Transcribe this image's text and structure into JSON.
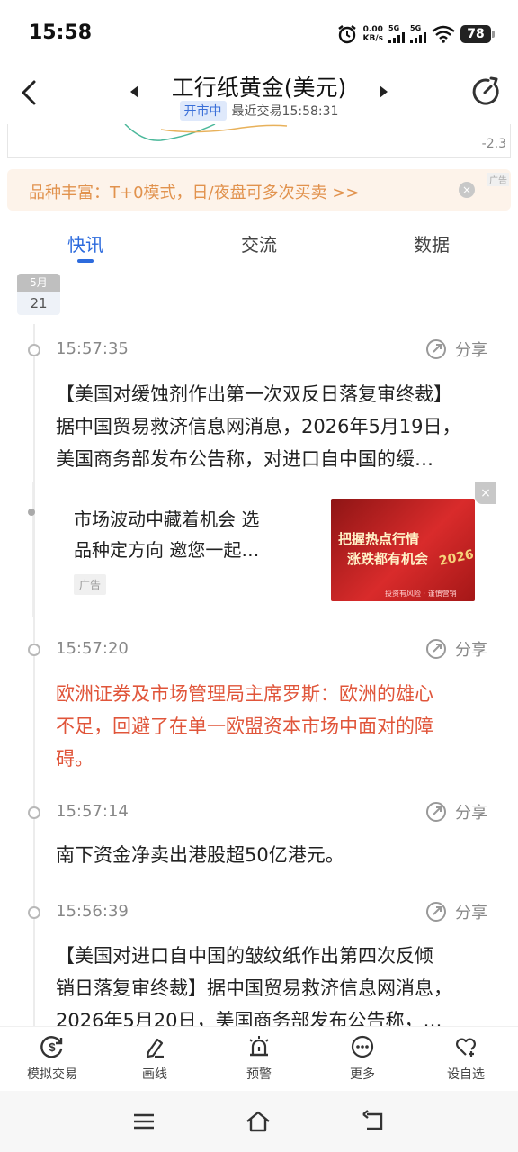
{
  "status_bar": {
    "time": "15:58",
    "net_speed_value": "0.00",
    "net_speed_unit": "KB/s",
    "signal1": "5G",
    "signal2": "5G",
    "battery": "78"
  },
  "header": {
    "title": "工行纸黄金(美元)",
    "market_status": "开市中",
    "last_trade": "最近交易15:58:31"
  },
  "chart_strip": {
    "value_label": "-2.3"
  },
  "ad_banner": {
    "text": "品种丰富：T+0模式，日/夜盘可多次买卖 >>",
    "tag": "广告",
    "close": "×"
  },
  "tabs": [
    {
      "label": "快讯",
      "active": true
    },
    {
      "label": "交流",
      "active": false
    },
    {
      "label": "数据",
      "active": false
    }
  ],
  "date": {
    "month": "5月",
    "day": "21"
  },
  "share_label": "分享",
  "news": [
    {
      "time": "15:57:35",
      "lines": [
        "【美国对缓蚀剂作出第一次双反日落复审终裁】",
        "据中国贸易救济信息网消息，2026年5月19日，",
        "美国商务部发布公告称，对进口自中国的缓…"
      ],
      "highlight": false
    },
    {
      "time": "15:57:20",
      "lines": [
        "欧洲证券及市场管理局主席罗斯：欧洲的雄心",
        "不足，回避了在单一欧盟资本市场中面对的障",
        "碍。"
      ],
      "highlight": true
    },
    {
      "time": "15:57:14",
      "lines": [
        "南下资金净卖出港股超50亿港元。"
      ],
      "highlight": false
    },
    {
      "time": "15:56:39",
      "lines": [
        "【美国对进口自中国的皱纹纸作出第四次反倾",
        "销日落复审终裁】据中国贸易救济信息网消息，",
        "2026年5月20日，美国商务部发布公告称，…"
      ],
      "highlight": false
    }
  ],
  "inline_ad": {
    "line1": "市场波动中藏着机会 选",
    "line2": "品种定方向 邀您一起…",
    "tag": "广告",
    "image_line1": "把握热点行情",
    "image_line2": "涨跌都有机会",
    "image_year": "2026",
    "image_footer": "投资有风险 · 谨慎营销",
    "close": "×"
  },
  "toolbar": [
    {
      "label": "模拟交易",
      "icon": "dollar-refresh-icon"
    },
    {
      "label": "画线",
      "icon": "pen-icon"
    },
    {
      "label": "预警",
      "icon": "alarm-light-icon"
    },
    {
      "label": "更多",
      "icon": "more-dots-icon"
    },
    {
      "label": "设自选",
      "icon": "heart-add-icon"
    }
  ]
}
